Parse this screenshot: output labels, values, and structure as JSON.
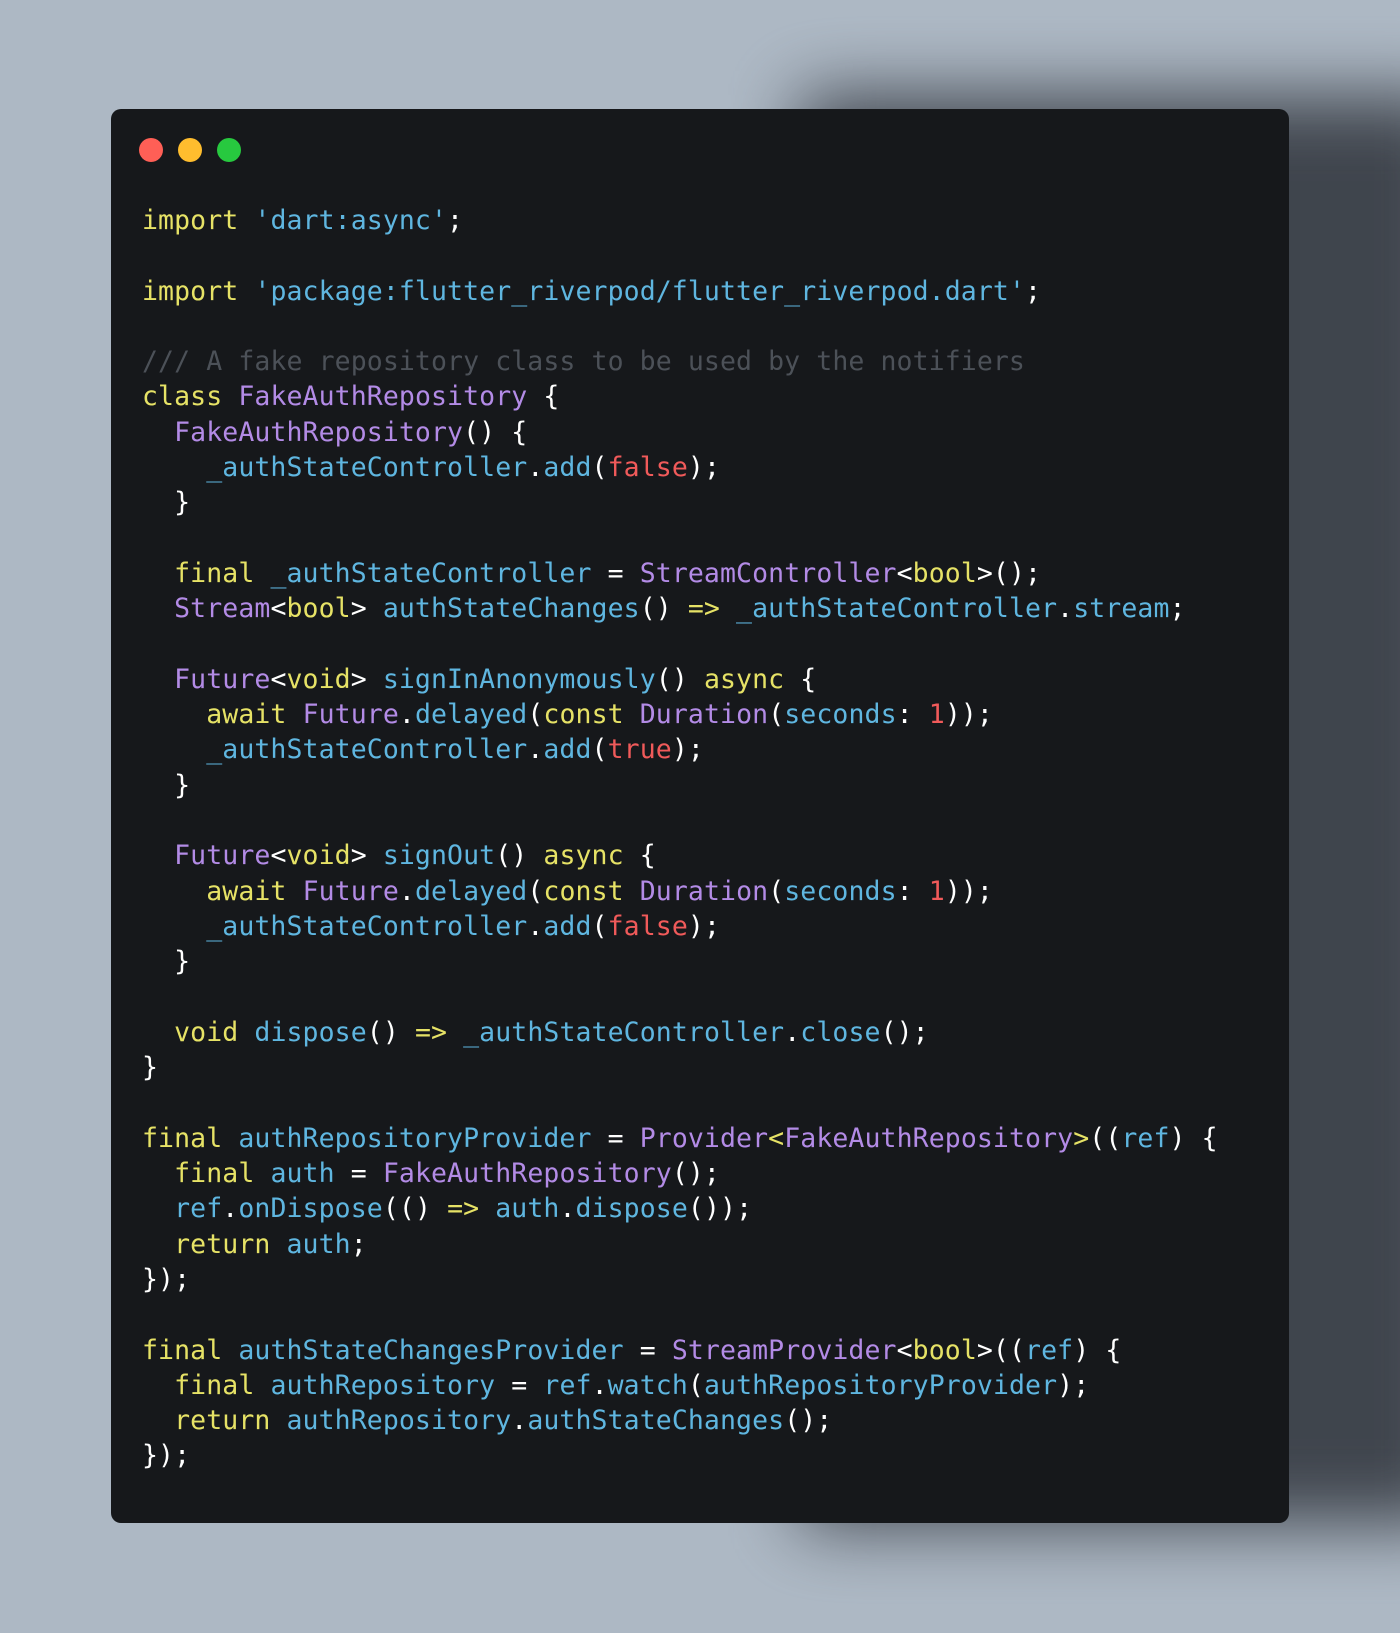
{
  "colors": {
    "background": "#adb8c4",
    "window": "#16181b",
    "keyword": "#e6e266",
    "string": "#5fb6e0",
    "type": "#b38be6",
    "identifier": "#5fb6e0",
    "literal": "#f05a5a",
    "comment": "#4c5158",
    "punctuation": "#ffffff"
  },
  "window_controls": [
    "close",
    "minimize",
    "maximize"
  ],
  "code_lines": [
    [
      [
        "keyword",
        "import"
      ],
      [
        "plain",
        " "
      ],
      [
        "string",
        "'dart:async'"
      ],
      [
        "plain",
        ";"
      ]
    ],
    [],
    [
      [
        "keyword",
        "import"
      ],
      [
        "plain",
        " "
      ],
      [
        "string",
        "'package:flutter_riverpod/flutter_riverpod.dart'"
      ],
      [
        "plain",
        ";"
      ]
    ],
    [],
    [
      [
        "comment",
        "/// A fake repository class to be used by the notifiers"
      ]
    ],
    [
      [
        "keyword",
        "class"
      ],
      [
        "plain",
        " "
      ],
      [
        "type",
        "FakeAuthRepository"
      ],
      [
        "plain",
        " {"
      ]
    ],
    [
      [
        "plain",
        "  "
      ],
      [
        "type",
        "FakeAuthRepository"
      ],
      [
        "plain",
        "() {"
      ]
    ],
    [
      [
        "plain",
        "    "
      ],
      [
        "identifier",
        "_authStateController"
      ],
      [
        "plain",
        "."
      ],
      [
        "identifier",
        "add"
      ],
      [
        "plain",
        "("
      ],
      [
        "literal",
        "false"
      ],
      [
        "plain",
        ");"
      ]
    ],
    [
      [
        "plain",
        "  }"
      ]
    ],
    [],
    [
      [
        "plain",
        "  "
      ],
      [
        "keyword",
        "final"
      ],
      [
        "plain",
        " "
      ],
      [
        "identifier",
        "_authStateController"
      ],
      [
        "plain",
        " = "
      ],
      [
        "type",
        "StreamController"
      ],
      [
        "plain",
        "<"
      ],
      [
        "keyword",
        "bool"
      ],
      [
        "plain",
        ">();"
      ]
    ],
    [
      [
        "plain",
        "  "
      ],
      [
        "type",
        "Stream"
      ],
      [
        "plain",
        "<"
      ],
      [
        "keyword",
        "bool"
      ],
      [
        "plain",
        "> "
      ],
      [
        "identifier",
        "authStateChanges"
      ],
      [
        "plain",
        "() "
      ],
      [
        "keyword",
        "=>"
      ],
      [
        "plain",
        " "
      ],
      [
        "identifier",
        "_authStateController"
      ],
      [
        "plain",
        "."
      ],
      [
        "identifier",
        "stream"
      ],
      [
        "plain",
        ";"
      ]
    ],
    [],
    [
      [
        "plain",
        "  "
      ],
      [
        "type",
        "Future"
      ],
      [
        "plain",
        "<"
      ],
      [
        "keyword",
        "void"
      ],
      [
        "plain",
        "> "
      ],
      [
        "identifier",
        "signInAnonymously"
      ],
      [
        "plain",
        "() "
      ],
      [
        "keyword",
        "async"
      ],
      [
        "plain",
        " {"
      ]
    ],
    [
      [
        "plain",
        "    "
      ],
      [
        "keyword",
        "await"
      ],
      [
        "plain",
        " "
      ],
      [
        "type",
        "Future"
      ],
      [
        "plain",
        "."
      ],
      [
        "identifier",
        "delayed"
      ],
      [
        "plain",
        "("
      ],
      [
        "keyword",
        "const"
      ],
      [
        "plain",
        " "
      ],
      [
        "type",
        "Duration"
      ],
      [
        "plain",
        "("
      ],
      [
        "identifier",
        "seconds"
      ],
      [
        "plain",
        ": "
      ],
      [
        "literal",
        "1"
      ],
      [
        "plain",
        "));"
      ]
    ],
    [
      [
        "plain",
        "    "
      ],
      [
        "identifier",
        "_authStateController"
      ],
      [
        "plain",
        "."
      ],
      [
        "identifier",
        "add"
      ],
      [
        "plain",
        "("
      ],
      [
        "literal",
        "true"
      ],
      [
        "plain",
        ");"
      ]
    ],
    [
      [
        "plain",
        "  }"
      ]
    ],
    [],
    [
      [
        "plain",
        "  "
      ],
      [
        "type",
        "Future"
      ],
      [
        "plain",
        "<"
      ],
      [
        "keyword",
        "void"
      ],
      [
        "plain",
        "> "
      ],
      [
        "identifier",
        "signOut"
      ],
      [
        "plain",
        "() "
      ],
      [
        "keyword",
        "async"
      ],
      [
        "plain",
        " {"
      ]
    ],
    [
      [
        "plain",
        "    "
      ],
      [
        "keyword",
        "await"
      ],
      [
        "plain",
        " "
      ],
      [
        "type",
        "Future"
      ],
      [
        "plain",
        "."
      ],
      [
        "identifier",
        "delayed"
      ],
      [
        "plain",
        "("
      ],
      [
        "keyword",
        "const"
      ],
      [
        "plain",
        " "
      ],
      [
        "type",
        "Duration"
      ],
      [
        "plain",
        "("
      ],
      [
        "identifier",
        "seconds"
      ],
      [
        "plain",
        ": "
      ],
      [
        "literal",
        "1"
      ],
      [
        "plain",
        "));"
      ]
    ],
    [
      [
        "plain",
        "    "
      ],
      [
        "identifier",
        "_authStateController"
      ],
      [
        "plain",
        "."
      ],
      [
        "identifier",
        "add"
      ],
      [
        "plain",
        "("
      ],
      [
        "literal",
        "false"
      ],
      [
        "plain",
        ");"
      ]
    ],
    [
      [
        "plain",
        "  }"
      ]
    ],
    [],
    [
      [
        "plain",
        "  "
      ],
      [
        "keyword",
        "void"
      ],
      [
        "plain",
        " "
      ],
      [
        "identifier",
        "dispose"
      ],
      [
        "plain",
        "() "
      ],
      [
        "keyword",
        "=>"
      ],
      [
        "plain",
        " "
      ],
      [
        "identifier",
        "_authStateController"
      ],
      [
        "plain",
        "."
      ],
      [
        "identifier",
        "close"
      ],
      [
        "plain",
        "();"
      ]
    ],
    [
      [
        "plain",
        "}"
      ]
    ],
    [],
    [
      [
        "keyword",
        "final"
      ],
      [
        "plain",
        " "
      ],
      [
        "identifier",
        "authRepositoryProvider"
      ],
      [
        "plain",
        " = "
      ],
      [
        "type",
        "Provider"
      ],
      [
        "keyword",
        "<"
      ],
      [
        "type",
        "FakeAuthRepository"
      ],
      [
        "keyword",
        ">"
      ],
      [
        "plain",
        "(("
      ],
      [
        "identifier",
        "ref"
      ],
      [
        "plain",
        ") {"
      ]
    ],
    [
      [
        "plain",
        "  "
      ],
      [
        "keyword",
        "final"
      ],
      [
        "plain",
        " "
      ],
      [
        "identifier",
        "auth"
      ],
      [
        "plain",
        " = "
      ],
      [
        "type",
        "FakeAuthRepository"
      ],
      [
        "plain",
        "();"
      ]
    ],
    [
      [
        "plain",
        "  "
      ],
      [
        "identifier",
        "ref"
      ],
      [
        "plain",
        "."
      ],
      [
        "identifier",
        "onDispose"
      ],
      [
        "plain",
        "(() "
      ],
      [
        "keyword",
        "=>"
      ],
      [
        "plain",
        " "
      ],
      [
        "identifier",
        "auth"
      ],
      [
        "plain",
        "."
      ],
      [
        "identifier",
        "dispose"
      ],
      [
        "plain",
        "());"
      ]
    ],
    [
      [
        "plain",
        "  "
      ],
      [
        "keyword",
        "return"
      ],
      [
        "plain",
        " "
      ],
      [
        "identifier",
        "auth"
      ],
      [
        "plain",
        ";"
      ]
    ],
    [
      [
        "plain",
        "});"
      ]
    ],
    [],
    [
      [
        "keyword",
        "final"
      ],
      [
        "plain",
        " "
      ],
      [
        "identifier",
        "authStateChangesProvider"
      ],
      [
        "plain",
        " = "
      ],
      [
        "type",
        "StreamProvider"
      ],
      [
        "plain",
        "<"
      ],
      [
        "keyword",
        "bool"
      ],
      [
        "plain",
        ">(("
      ],
      [
        "identifier",
        "ref"
      ],
      [
        "plain",
        ") {"
      ]
    ],
    [
      [
        "plain",
        "  "
      ],
      [
        "keyword",
        "final"
      ],
      [
        "plain",
        " "
      ],
      [
        "identifier",
        "authRepository"
      ],
      [
        "plain",
        " = "
      ],
      [
        "identifier",
        "ref"
      ],
      [
        "plain",
        "."
      ],
      [
        "identifier",
        "watch"
      ],
      [
        "plain",
        "("
      ],
      [
        "identifier",
        "authRepositoryProvider"
      ],
      [
        "plain",
        ");"
      ]
    ],
    [
      [
        "plain",
        "  "
      ],
      [
        "keyword",
        "return"
      ],
      [
        "plain",
        " "
      ],
      [
        "identifier",
        "authRepository"
      ],
      [
        "plain",
        "."
      ],
      [
        "identifier",
        "authStateChanges"
      ],
      [
        "plain",
        "();"
      ]
    ],
    [
      [
        "plain",
        "});"
      ]
    ]
  ]
}
